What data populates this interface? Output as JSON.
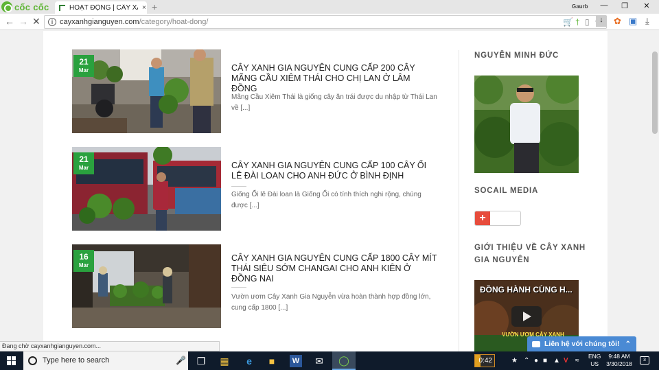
{
  "browser": {
    "brand": "cốc cốc",
    "tab_title": "HOẠT ĐỘNG | CÂY XANH",
    "tab_close": "×",
    "new_tab": "+",
    "user_name": "Gaurb",
    "url_domain": "cayxanhgianguyen.com",
    "url_path": "/category/hoat-dong/",
    "status_text": "Đang chờ cayxanhgianguyen.com..."
  },
  "posts": [
    {
      "day": "21",
      "month": "Mar",
      "title": "CÂY XANH GIA NGUYÊN CUNG CẤP 200 CÂY MÃNG CẦU XIÊM THÁI CHO CHỊ LAN Ở LÂM ĐỒNG",
      "excerpt": "Mãng Cầu Xiêm Thái là giống cây ăn trái được du nhập từ Thái Lan về [...]"
    },
    {
      "day": "21",
      "month": "Mar",
      "title": "CÂY XANH GIA NGUYÊN CUNG CẤP 100 CÂY ỔI LÊ ĐÀI LOAN CHO ANH ĐỨC Ở BÌNH ĐỊNH",
      "excerpt": "Giống Ổi lê Đài loan là Giống Ổi có tính thích nghi rộng, chúng được [...]"
    },
    {
      "day": "16",
      "month": "Mar",
      "title": "CÂY XANH GIA NGUYÊN CUNG CẤP 1800 CÂY MÍT THÁI SIÊU SỚM CHANGAI CHO ANH KIÊN Ở ĐỒNG NAI",
      "excerpt": "Vườn ươm Cây Xanh Gia Nguyễn vừa hoàn thành hợp đồng lớn, cung cấp 1800 [...]"
    }
  ],
  "sidebar": {
    "profile_heading": "NGUYỄN MINH ĐỨC",
    "social_heading": "SOCAIL MEDIA",
    "social_button": "+",
    "intro_heading": "GIỚI THIỆU VỀ CÂY XANH GIA NGUYÊN",
    "video_title": "ĐỒNG HÀNH CÙNG H...",
    "video_caption": "VƯỜN ƯƠM CÂY XANH"
  },
  "chat": {
    "label": "Liên hệ với chúng tôi!"
  },
  "taskbar": {
    "search_placeholder": "Type here to search",
    "battery_label": "0:42",
    "lang_top": "ENG",
    "lang_bottom": "US",
    "time": "9:48 AM",
    "date": "3/30/2018",
    "notifications": "3"
  },
  "colors": {
    "accent_green": "#2aa13e",
    "chat_blue": "#4a8ad4",
    "gplus_red": "#e74c3c"
  }
}
